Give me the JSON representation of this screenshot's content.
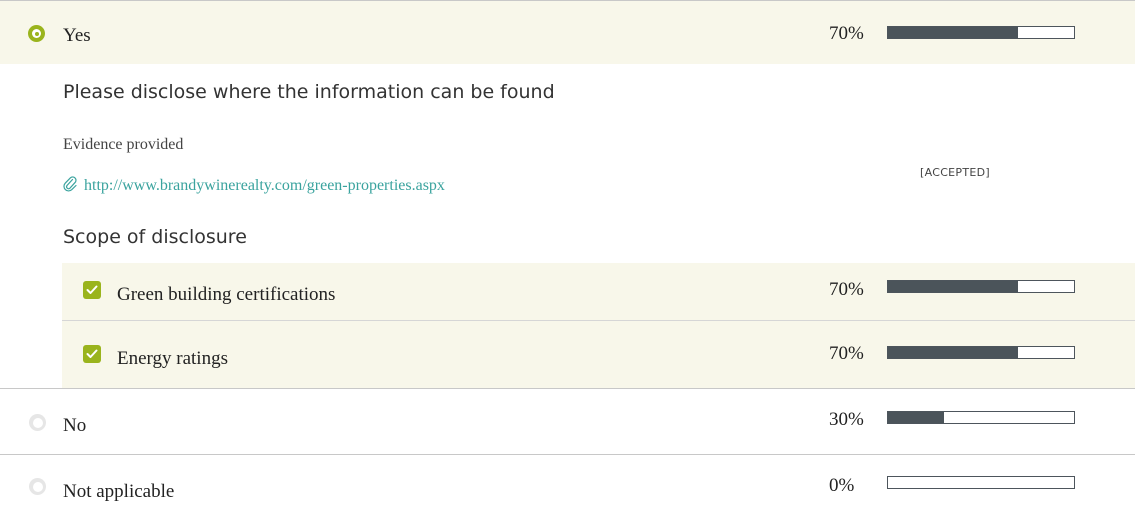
{
  "options": [
    {
      "label": "Yes",
      "selected": true,
      "percent_text": "70%",
      "percent": 70
    },
    {
      "label": "No",
      "selected": false,
      "percent_text": "30%",
      "percent": 30
    },
    {
      "label": "Not applicable",
      "selected": false,
      "percent_text": "0%",
      "percent": 0
    }
  ],
  "disclosure": {
    "heading": "Please disclose where the information can be found",
    "evidence_label": "Evidence provided",
    "evidence_link": "http://www.brandywinerealty.com/green-properties.aspx",
    "evidence_status": "[ACCEPTED]"
  },
  "scope": {
    "heading": "Scope of disclosure",
    "items": [
      {
        "label": "Green building certifications",
        "checked": true,
        "percent_text": "70%",
        "percent": 70
      },
      {
        "label": "Energy ratings",
        "checked": true,
        "percent_text": "70%",
        "percent": 70
      }
    ]
  },
  "colors": {
    "accent": "#9ab41d",
    "bar_fill": "#4b545a",
    "link": "#3aa39e",
    "selected_bg": "#f8f7ea"
  },
  "icons": {
    "radio_selected": "radio-selected-icon",
    "radio_unselected": "radio-unselected-icon",
    "checkbox_checked": "checkbox-checked-icon",
    "link": "paperclip-icon"
  }
}
